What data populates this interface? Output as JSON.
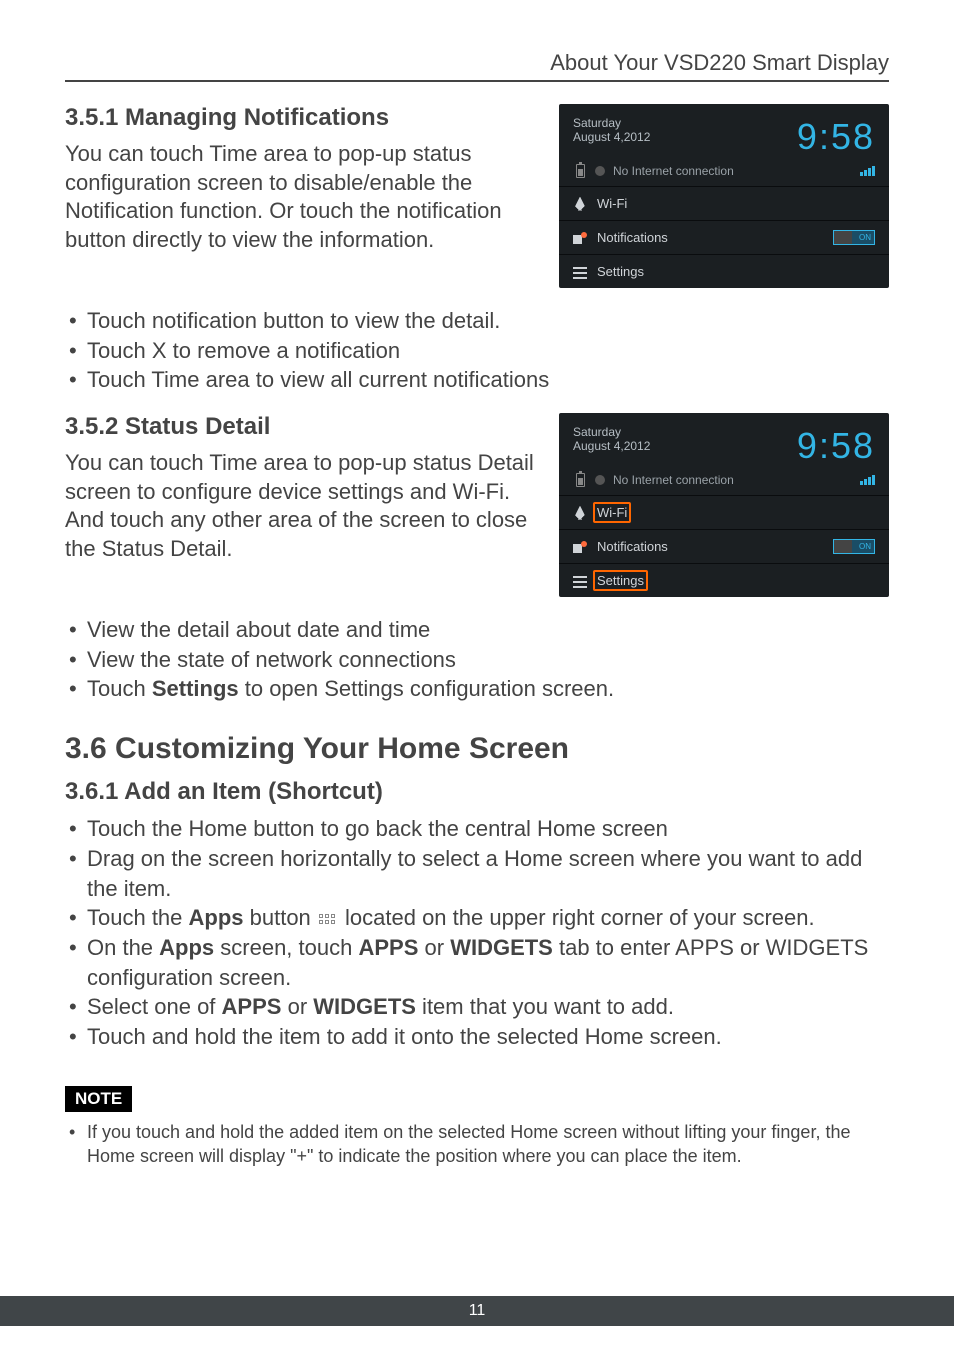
{
  "header": {
    "title": "About Your VSD220 Smart Display"
  },
  "s351": {
    "heading": "3.5.1  Managing Notifications",
    "para": "You can touch Time area to pop-up status configuration screen to disable/enable the Notification function. Or touch the notification button directly to view the information.",
    "bullets": [
      "Touch notification button to view the detail.",
      "Touch X to remove a notification",
      "Touch Time area to view all current notifications"
    ]
  },
  "s352": {
    "heading": "3.5.2  Status Detail",
    "para": "You can touch Time area to pop-up status Detail screen to configure device settings and Wi-Fi. And touch any other area of the screen to close the Status Detail.",
    "bullets_pre": [
      "View the detail about date and time",
      "View the state of network connections"
    ],
    "bullet_settings_prefix": "Touch ",
    "bullet_settings_bold": "Settings",
    "bullet_settings_suffix": " to open Settings configuration screen."
  },
  "panel": {
    "day": "Saturday",
    "date": "August 4,2012",
    "time": "9:58",
    "status": "No Internet connection",
    "wifi": "Wi-Fi",
    "notifications": "Notifications",
    "toggle": "ON",
    "settings": "Settings"
  },
  "s36": {
    "heading": "3.6  Customizing Your Home Screen"
  },
  "s361": {
    "heading": "3.6.1  Add an Item (Shortcut)",
    "b1": "Touch the Home button to go back the central Home screen",
    "b2": "Drag on the screen horizontally to select a Home screen where you want to add the item.",
    "b3_prefix": "Touch the ",
    "b3_bold": "Apps",
    "b3_mid": " button ",
    "b3_suffix": " located on the upper right corner of your screen.",
    "b4_prefix": "On the ",
    "b4_b1": "Apps",
    "b4_mid1": " screen, touch ",
    "b4_b2": "APPS",
    "b4_mid2": " or ",
    "b4_b3": "WIDGETS",
    "b4_suffix": " tab to enter APPS or WIDGETS configuration screen.",
    "b5_prefix": "Select one of ",
    "b5_b1": "APPS",
    "b5_mid": " or ",
    "b5_b2": "WIDGETS",
    "b5_suffix": " item that you want to add.",
    "b6": "Touch and hold the item to add it onto the selected Home screen."
  },
  "note": {
    "label": "NOTE",
    "text": "If you touch and hold the added item on the selected Home screen without lifting your finger, the Home screen will display \"+\" to indicate the position where you can place the item."
  },
  "footer": {
    "page": "11"
  }
}
